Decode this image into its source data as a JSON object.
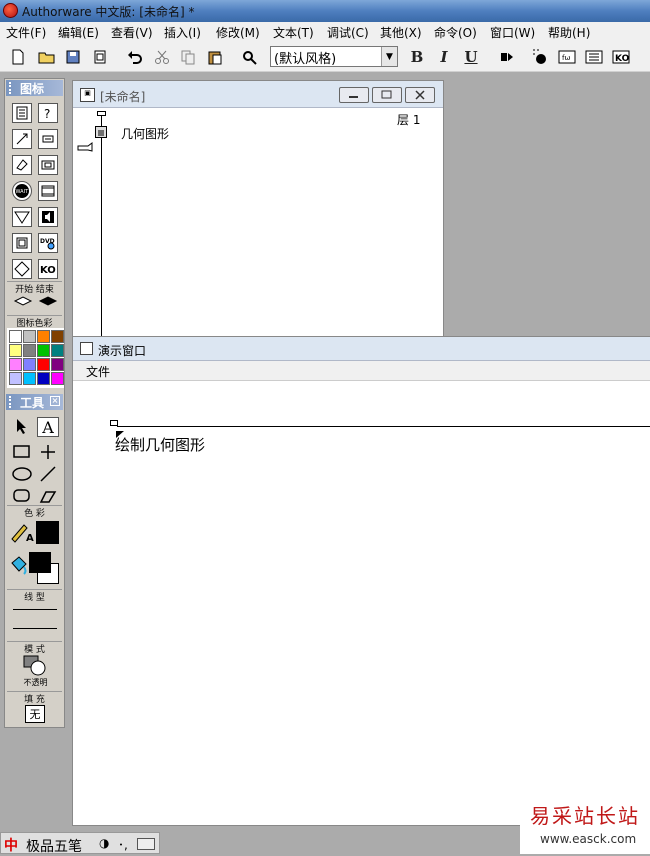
{
  "titlebar": {
    "title": "Authorware 中文版: [未命名] *"
  },
  "menu": {
    "items": [
      "文件(F)",
      "编辑(E)",
      "查看(V)",
      "插入(I)",
      "修改(M)",
      "文本(T)",
      "调试(C)",
      "其他(X)",
      "命令(O)",
      "窗口(W)",
      "帮助(H)"
    ]
  },
  "toolbar": {
    "style_value": "(默认风格)",
    "bold_label": "B",
    "italic_label": "I",
    "underline_label": "U"
  },
  "icon_palette": {
    "title": "图标",
    "start_end_label": "开始 结束",
    "color_label": "图标色彩",
    "colors": [
      "#ffffff",
      "#c0c0c0",
      "#ff8000",
      "#804000",
      "#ffff80",
      "#808080",
      "#00c000",
      "#008080",
      "#ff80ff",
      "#8080ff",
      "#ff0000",
      "#800080",
      "#c0c0ff",
      "#00c0ff",
      "#0000c0",
      "#ff00ff"
    ]
  },
  "tools_palette": {
    "title": "工具",
    "text_tool_label": "A",
    "color_label": "色 彩",
    "line_label": "线 型",
    "mode_label": "模 式",
    "mode_value": "不透明",
    "fill_label": "填 充",
    "fill_value": "无"
  },
  "flow_window": {
    "title": "[未命名]",
    "level_label": "层 1",
    "icon_label": "几何图形"
  },
  "presentation_window": {
    "title": "演示窗口",
    "menu_file": "文件",
    "content_text": "绘制几何图形"
  },
  "taskbar": {
    "ime_label": "极品五笔"
  },
  "watermark": {
    "name": "易采站长站",
    "url": "www.easck.com"
  }
}
